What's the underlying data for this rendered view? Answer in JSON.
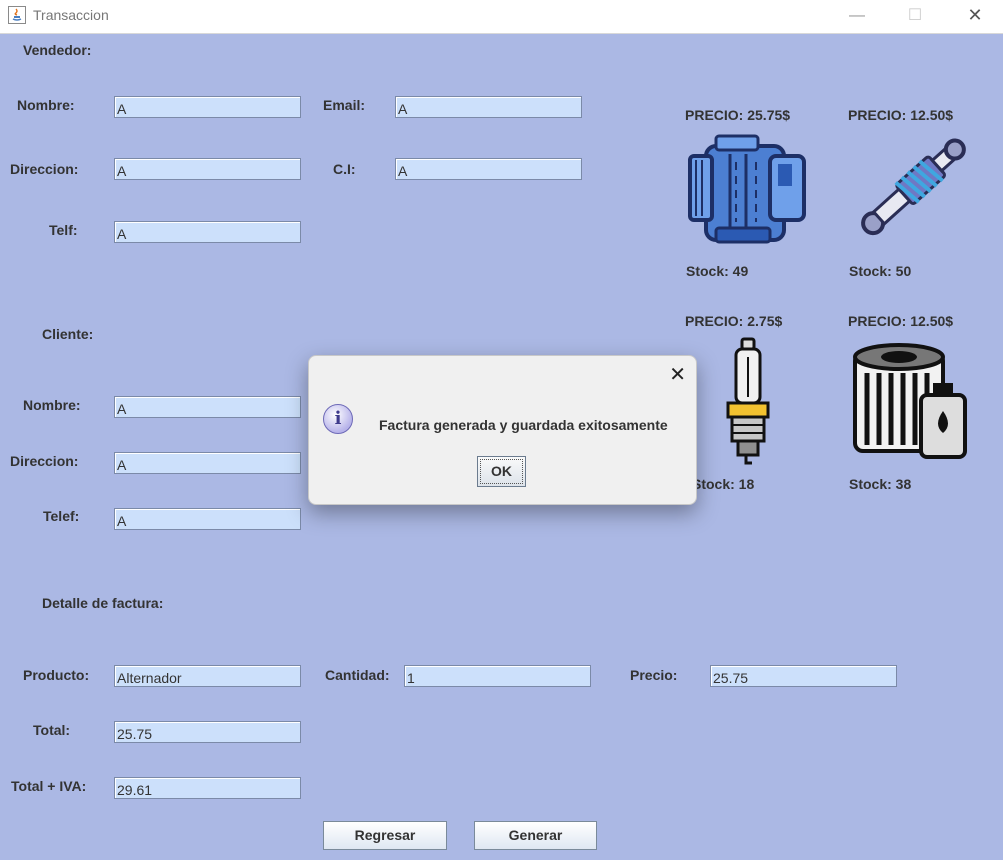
{
  "window": {
    "title": "Transaccion",
    "controls": {
      "minimize": "—",
      "maximize": "☐",
      "close": "✕"
    }
  },
  "vendedor": {
    "heading": "Vendedor:",
    "nombre_label": "Nombre:",
    "nombre_value": "A",
    "email_label": "Email:",
    "email_value": "A",
    "direccion_label": "Direccion:",
    "direccion_value": "A",
    "ci_label": "C.I:",
    "ci_value": "A",
    "telf_label": "Telf:",
    "telf_value": "A"
  },
  "cliente": {
    "heading": "Cliente:",
    "nombre_label": "Nombre:",
    "nombre_value": "A",
    "direccion_label": "Direccion:",
    "direccion_value": "A",
    "telef_label": "Telef:",
    "telef_value": "A"
  },
  "detalle": {
    "heading": "Detalle de factura:",
    "producto_label": "Producto:",
    "producto_value": "Alternador",
    "cantidad_label": "Cantidad:",
    "cantidad_value": "1",
    "precio_label": "Precio:",
    "precio_value": "25.75",
    "total_label": "Total:",
    "total_value": "25.75",
    "total_iva_label": "Total + IVA:",
    "total_iva_value": "29.61"
  },
  "products": [
    {
      "icon": "alternator-icon",
      "price": "PRECIO: 25.75$",
      "stock": "Stock: 49"
    },
    {
      "icon": "shock-absorber-icon",
      "price": "PRECIO: 12.50$",
      "stock": "Stock: 50"
    },
    {
      "icon": "spark-plug-icon",
      "price": "PRECIO: 2.75$",
      "stock": "Stock: 18"
    },
    {
      "icon": "oil-filter-icon",
      "price": "PRECIO: 12.50$",
      "stock": "Stock: 38"
    }
  ],
  "buttons": {
    "regresar": "Regresar",
    "generar": "Generar"
  },
  "dialog": {
    "message": "Factura generada y guardada exitosamente",
    "ok": "OK",
    "close": "✕",
    "info_glyph": "i"
  },
  "colors": {
    "background": "#abb8e4",
    "field": "#cce0fb",
    "dialog": "#f0f0f0"
  }
}
